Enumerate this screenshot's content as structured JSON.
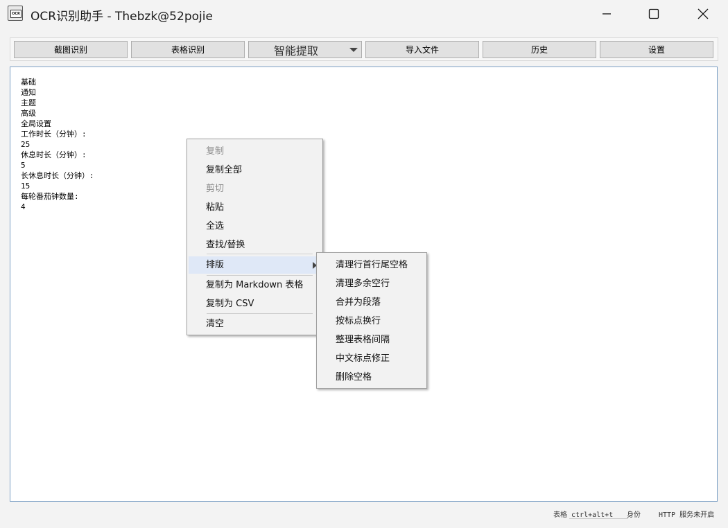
{
  "window": {
    "title": "OCR识别助手 - Thebzk@52pojie",
    "icon_label": "OCR"
  },
  "toolbar": {
    "screenshot_ocr": "截图识别",
    "table_ocr": "表格识别",
    "smart_extract": "智能提取",
    "import_file": "导入文件",
    "history": "历史",
    "settings": "设置"
  },
  "editor": {
    "lines": [
      "基础",
      "通知",
      "主题",
      "高级",
      "全局设置",
      "工作时长（分钟）:",
      "25",
      "休息时长（分钟）:",
      "5",
      "长休息时长（分钟）:",
      "15",
      "每轮番茄钟数量:",
      "4"
    ]
  },
  "context_menu": {
    "copy": "复制",
    "copy_all": "复制全部",
    "cut": "剪切",
    "paste": "粘贴",
    "select_all": "全选",
    "find_replace": "查找/替换",
    "layout": "排版",
    "copy_markdown": "复制为 Markdown 表格",
    "copy_csv": "复制为 CSV",
    "clear": "清空"
  },
  "layout_submenu": {
    "trim_lines": "清理行首行尾空格",
    "remove_blank_lines": "清理多余空行",
    "merge_paragraph": "合并为段落",
    "break_by_punct": "按标点换行",
    "tidy_table_spacing": "整理表格间隔",
    "fix_cn_punct": "中文标点修正",
    "delete_spaces": "删除空格"
  },
  "status": {
    "table_hotkey": "表格 ctrl+alt+t",
    "id_label": "身份",
    "http_status": "HTTP 服务未开启"
  },
  "colors": {
    "accent_border": "#7a9fc4",
    "highlight": "#dfe8f7"
  }
}
